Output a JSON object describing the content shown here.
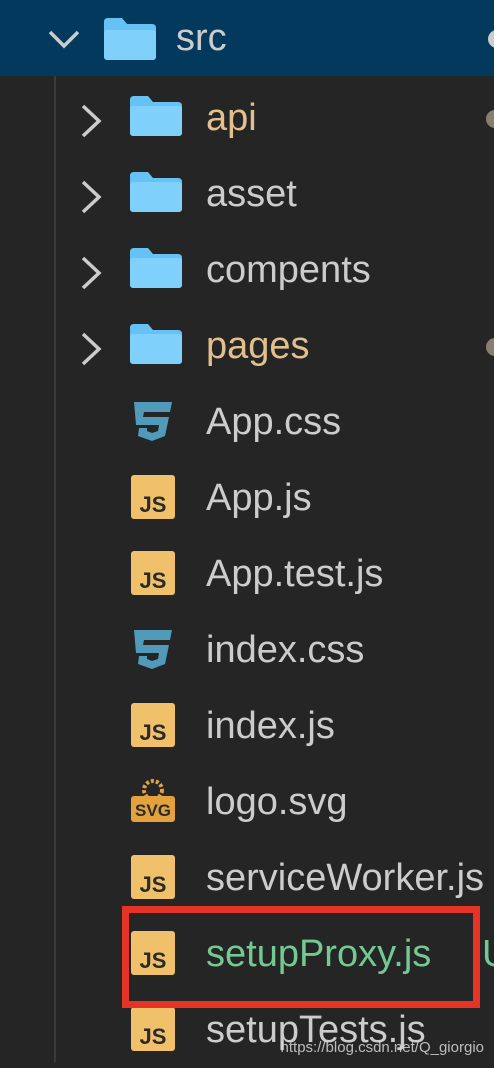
{
  "explorer": {
    "root": {
      "name": "src",
      "expanded": true,
      "icon": "folder-open-icon",
      "colors": {
        "selected_bg": "#04395e",
        "folder": "#66c2f5",
        "label": "#cccccc"
      }
    },
    "folders": [
      {
        "name": "api",
        "status": "modified",
        "icon": "folder-icon",
        "dot_color": "#8a7f6c"
      },
      {
        "name": "asset",
        "status": "none",
        "icon": "folder-icon"
      },
      {
        "name": "compents",
        "status": "none",
        "icon": "folder-icon"
      },
      {
        "name": "pages",
        "status": "modified",
        "icon": "folder-icon",
        "dot_color": "#8a7f6c"
      }
    ],
    "files": [
      {
        "name": "App.css",
        "icon": "css-icon",
        "status": "none"
      },
      {
        "name": "App.js",
        "icon": "js-icon",
        "status": "none"
      },
      {
        "name": "App.test.js",
        "icon": "js-icon",
        "status": "none"
      },
      {
        "name": "index.css",
        "icon": "css-icon",
        "status": "none"
      },
      {
        "name": "index.js",
        "icon": "js-icon",
        "status": "none"
      },
      {
        "name": "logo.svg",
        "icon": "svg-icon",
        "status": "none"
      },
      {
        "name": "serviceWorker.js",
        "icon": "js-icon",
        "status": "none"
      },
      {
        "name": "setupProxy.js",
        "icon": "js-icon",
        "status": "untracked",
        "highlighted": true,
        "status_letter": "U"
      },
      {
        "name": "setupTests.js",
        "icon": "js-icon",
        "status": "none"
      }
    ],
    "status_colors": {
      "modified": "#e2c08d",
      "untracked": "#73c991",
      "highlight_box": "#e53325"
    }
  },
  "watermark": "https://blog.csdn.net/Q_giorgio"
}
